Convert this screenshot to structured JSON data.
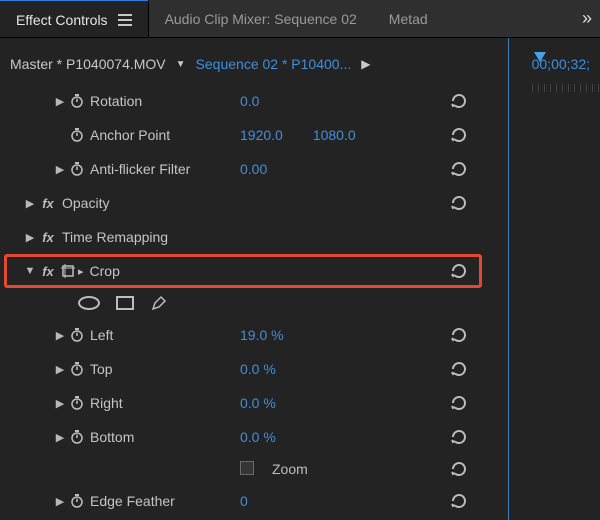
{
  "tabs": {
    "effect_controls": "Effect Controls",
    "audio_mixer": "Audio Clip Mixer: Sequence 02",
    "metadata": "Metad"
  },
  "subheader": {
    "master": "Master * P1040074.MOV",
    "sequence": "Sequence 02 * P10400...",
    "timecode": "00;00;32;"
  },
  "props": {
    "rotation": {
      "label": "Rotation",
      "value": "0.0"
    },
    "anchor": {
      "label": "Anchor Point",
      "x": "1920.0",
      "y": "1080.0"
    },
    "antiflicker": {
      "label": "Anti-flicker Filter",
      "value": "0.00"
    },
    "opacity": {
      "label": "Opacity"
    },
    "timeremap": {
      "label": "Time Remapping"
    },
    "crop": {
      "label": "Crop",
      "left": {
        "label": "Left",
        "value": "19.0 %"
      },
      "top": {
        "label": "Top",
        "value": "0.0 %"
      },
      "right": {
        "label": "Right",
        "value": "0.0 %"
      },
      "bottom": {
        "label": "Bottom",
        "value": "0.0 %"
      },
      "zoom": {
        "label": "Zoom"
      },
      "feather": {
        "label": "Edge Feather",
        "value": "0"
      }
    }
  }
}
